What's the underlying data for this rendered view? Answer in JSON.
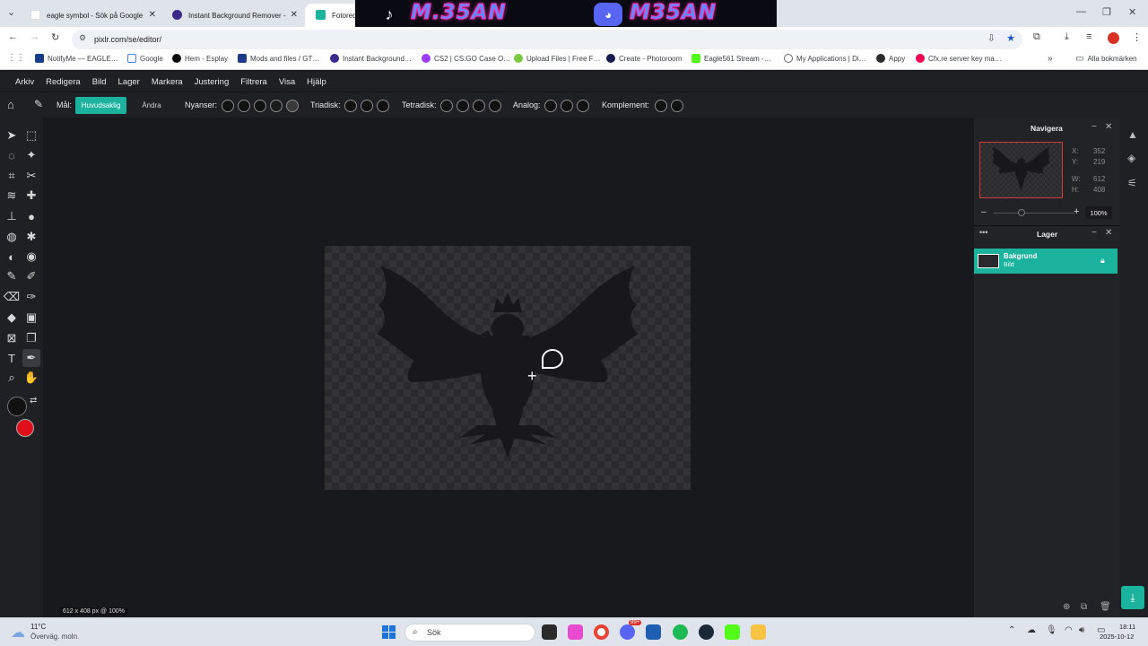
{
  "browser": {
    "tabs": [
      {
        "label": "eagle symbol - Sök på Google",
        "close": "✕"
      },
      {
        "label": "Instant Background Remover -",
        "close": "✕"
      },
      {
        "label": "Fotored",
        "close": ""
      }
    ],
    "url": "pixlr.com/se/editor/",
    "bookmarks": [
      "NotifyMe — EAGLE…",
      "Google",
      "Hem - Esplay",
      "Mods and files / GT…",
      "Instant Background…",
      "CS2 | CS:GO Case O…",
      "Upload Files | Free F…",
      "Create - Photoroom",
      "Eagle561 Stream -…",
      "My Applications | Di…",
      "Appy",
      "Cfx.re server key ma…"
    ],
    "all_bookmarks": "Alla bokmärken",
    "more_bookmarks": "»",
    "banner_texts": [
      "M.35AN",
      "M35AN"
    ]
  },
  "menu": [
    "Arkiv",
    "Redigera",
    "Bild",
    "Lager",
    "Markera",
    "Justering",
    "Filtrera",
    "Visa",
    "Hjälp"
  ],
  "options": {
    "target_label": "Mål:",
    "main_btn": "Huvudsaklig",
    "change_btn": "Ändra",
    "shades": "Nyanser:",
    "triadic": "Triadisk:",
    "tetradic": "Tetradisk:",
    "analog": "Analog:",
    "complement": "Komplement:"
  },
  "navigator": {
    "title": "Navigera",
    "x_label": "X:",
    "x_val": "352",
    "y_label": "Y:",
    "y_val": "219",
    "w_label": "W:",
    "w_val": "612",
    "h_label": "H:",
    "h_val": "408",
    "zoom": "100%",
    "zoom_minus": "–",
    "zoom_plus": "+"
  },
  "layers": {
    "title": "Lager",
    "menu": "•••",
    "items": [
      {
        "name": "Bakgrund",
        "type": "Bild"
      }
    ]
  },
  "status": "612 x 408 px @ 100%",
  "taskbar": {
    "weather_temp": "11°C",
    "weather_desc": "Överväg. moln.",
    "search": "Sök",
    "time": "18:11",
    "date": "2025-10-12",
    "badge": "99+"
  },
  "colors": {
    "accent": "#1bb39d",
    "foreground": "#111111",
    "background": "#e0101b"
  }
}
